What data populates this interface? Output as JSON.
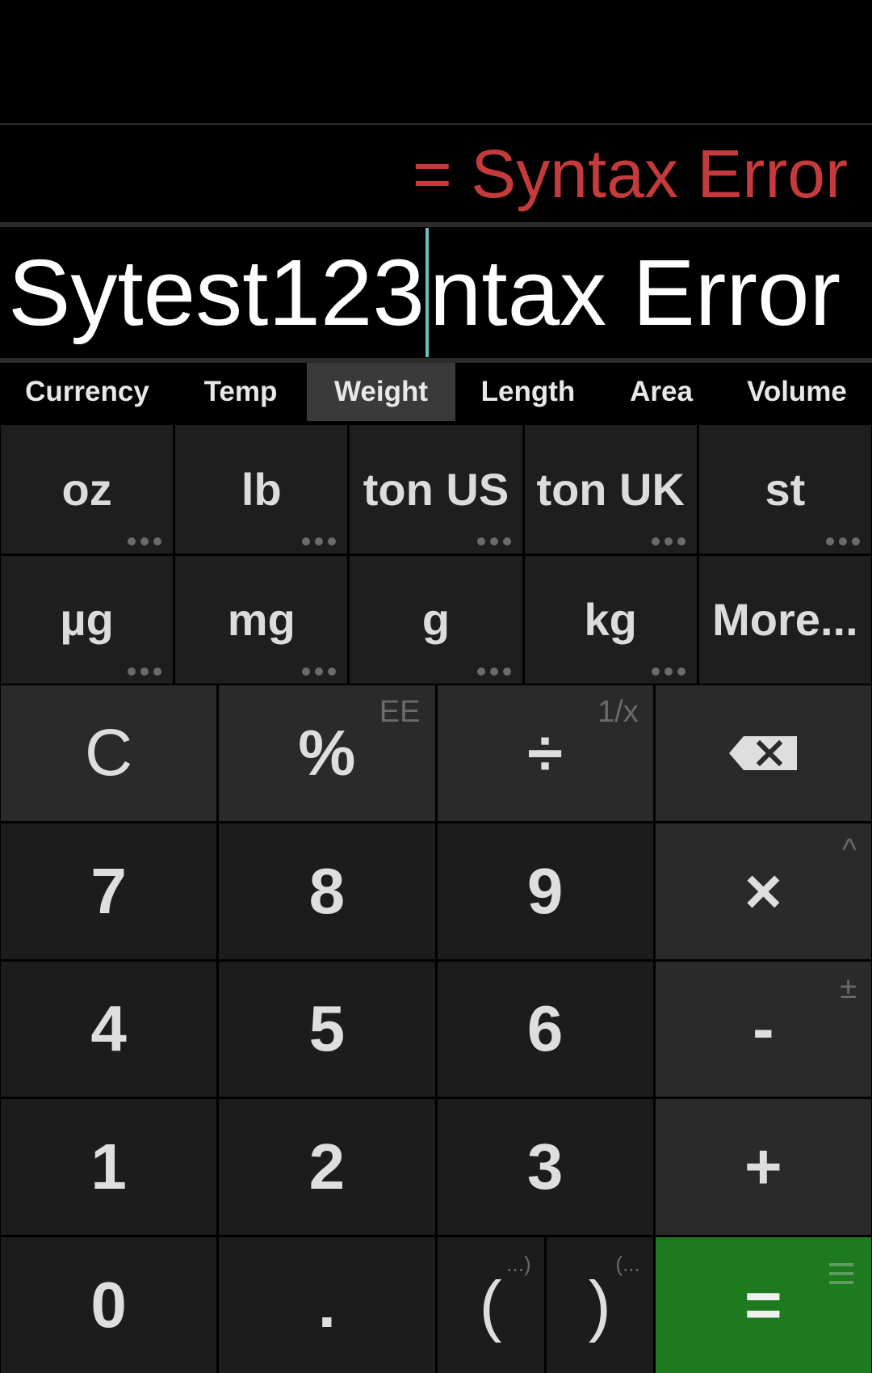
{
  "display": {
    "result": "= Syntax Error",
    "expression_before_cursor": "Sytest123",
    "expression_after_cursor": "ntax Error"
  },
  "tabs": [
    {
      "label": "Currency",
      "active": false
    },
    {
      "label": "Temp",
      "active": false
    },
    {
      "label": "Weight",
      "active": true
    },
    {
      "label": "Length",
      "active": false
    },
    {
      "label": "Area",
      "active": false
    },
    {
      "label": "Volume",
      "active": false
    }
  ],
  "units": {
    "oz": "oz",
    "lb": "lb",
    "ton_us": "ton US",
    "ton_uk": "ton UK",
    "st": "st",
    "ug": "µg",
    "mg": "mg",
    "g": "g",
    "kg": "kg",
    "more": "More..."
  },
  "keys": {
    "clear": "C",
    "percent": "%",
    "percent_alt": "EE",
    "divide": "÷",
    "divide_alt": "1/x",
    "backspace_icon": "backspace-icon",
    "seven": "7",
    "eight": "8",
    "nine": "9",
    "multiply": "×",
    "multiply_alt": "^",
    "four": "4",
    "five": "5",
    "six": "6",
    "minus": "-",
    "minus_alt": "±",
    "one": "1",
    "two": "2",
    "three": "3",
    "plus": "+",
    "zero": "0",
    "dot": ".",
    "open_paren": "(",
    "open_paren_alt": "...)",
    "close_paren": ")",
    "close_paren_alt": "(...",
    "equals": "=",
    "equals_alt_icon": "menu-icon"
  },
  "colors": {
    "error": "#c53a3a",
    "caret": "#6fc2c0",
    "equals_key": "#1e7a1e",
    "active_tab": "#3a3a3a"
  }
}
